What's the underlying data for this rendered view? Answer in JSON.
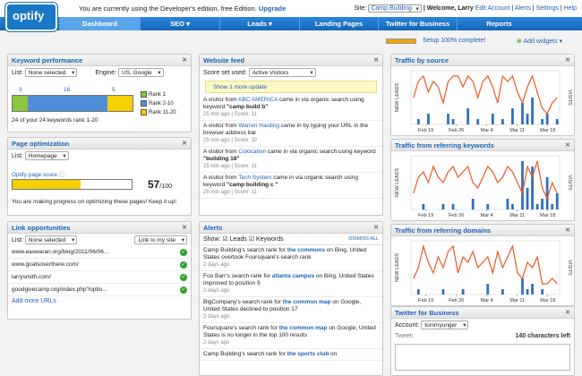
{
  "logo": "optify",
  "header": {
    "dev_note": "You are currently using the Developer's edition, free Edition.",
    "upgrade": "Upgrade",
    "site_label": "Site:",
    "site_value": "Camp Building",
    "welcome": "| Welcome, Larry",
    "links": [
      "Edit Account",
      "Alerts",
      "Settings",
      "Help"
    ]
  },
  "nav": {
    "tabs": [
      "Dashboard",
      "SEO ▾",
      "Leads ▾",
      "Landing Pages",
      "Twitter for Business",
      "Reports"
    ],
    "active": 0
  },
  "setup": {
    "progress": 1.0,
    "text": "Setup 100% complete!",
    "add_widgets": "Add widgets ▾"
  },
  "keyword": {
    "title": "Keyword performance",
    "list_label": "List:",
    "list_value": "None selected",
    "engine_label": "Engine:",
    "engine_value": "US, Google",
    "counts": [
      "3",
      "16",
      "5"
    ],
    "segments": [
      3,
      16,
      5
    ],
    "legend": [
      "Rank 1",
      "Rank 2-10",
      "Rank 11-20"
    ],
    "colors": [
      "#8cc63f",
      "#4e8ed8",
      "#f5d000"
    ],
    "summary": "24 of your 24 keywords rank 1-20"
  },
  "optimization": {
    "title": "Page optimization",
    "list_label": "List:",
    "list_value": "Homepage",
    "score_label": "Optify page score",
    "score": "57",
    "score_max": "/100",
    "score_fraction": 0.57,
    "note": "You are making progress on optimizing these pages! Keep it up!"
  },
  "links": {
    "title": "Link opportunities",
    "list_label": "List:",
    "list_value": "None selected",
    "filter": "Link to my site",
    "rows": [
      "www.easwaran.org/blog/2011/06/06...",
      "www.goatsoverthere.com/",
      "larrysmith.com/",
      "goodgivecamp.org/index.php?optio..."
    ],
    "add_more": "Add more URLs"
  },
  "feed": {
    "title": "Website feed",
    "score_label": "Score set used:",
    "score_value": "Active Visitors",
    "update": "Show 1 more update",
    "items": [
      {
        "pre": "A visitor from ",
        "org": "ABC AMERICA",
        "mid": " came in via organic search using keyword ",
        "kw": "\"camp build b\"",
        "meta": "25 min ago | Score: 11"
      },
      {
        "pre": "A visitor from ",
        "org": "Warren Harding",
        "mid": " came in by typing your URL in the browser address bar",
        "kw": "",
        "meta": "25 min ago | Score: 32"
      },
      {
        "pre": "A visitor from ",
        "org": "Colocation",
        "mid": " came in via organic search using keyword ",
        "kw": "\"building 18\"",
        "meta": "25 min ago | Score: 11"
      },
      {
        "pre": "A visitor from ",
        "org": "Tech System",
        "mid": " came in via organic search using keyword ",
        "kw": "\"camp building c \"",
        "meta": "25 min ago | Score: 11"
      }
    ]
  },
  "alerts": {
    "title": "Alerts",
    "show_label": "Show:",
    "leads": "Leads",
    "keywords": "Keywords",
    "dismiss": "DISMISS ALL",
    "items": [
      {
        "pre": "Camp Building's search rank for ",
        "kw": "the commons",
        "post": " on Bing, United States overtook Foursquare's search rank",
        "meta": "2 days ago"
      },
      {
        "pre": "Foo Barr's search rank for ",
        "kw": "atlanta campus",
        "post": " on Bing, United States improved to position 9",
        "meta": "2 days ago"
      },
      {
        "pre": "BigCompany's search rank for ",
        "kw": "the common map",
        "post": " on Google, United States declined to position 17",
        "meta": "2 days ago"
      },
      {
        "pre": "Foursquare's search rank for ",
        "kw": "the common map",
        "post": " on Google, United States is no longer in the top 100 results",
        "meta": "2 days ago"
      },
      {
        "pre": "Camp Building's search rank for ",
        "kw": "the sports club",
        "post": " on",
        "meta": ""
      }
    ]
  },
  "charts": [
    {
      "title": "Traffic by source",
      "ylabel": "NEW LEADS",
      "y2label": "VISITS",
      "xticks": [
        "Feb 19",
        "Feb 26",
        "Mar 4",
        "Mar 11",
        "Mar 18"
      ]
    },
    {
      "title": "Traffic from referring keywords",
      "ylabel": "NEW LEADS",
      "y2label": "VISITS",
      "xticks": [
        "Feb 19",
        "Feb 26",
        "Mar 4",
        "Mar 11",
        "Mar 18"
      ]
    },
    {
      "title": "Traffic from referring domains",
      "ylabel": "NEW LEADS",
      "y2label": "VISITS",
      "xticks": [
        "Feb 19",
        "Feb 26",
        "Mar 4",
        "Mar 11",
        "Mar 18"
      ]
    }
  ],
  "chart_data": [
    {
      "type": "line",
      "title": "Traffic by source",
      "visits": [
        5,
        8,
        9,
        6,
        8,
        7,
        4,
        8,
        9,
        9,
        7,
        9,
        8,
        5,
        8,
        9,
        7,
        4,
        9,
        8,
        9,
        6,
        4,
        7,
        9,
        6,
        3,
        2,
        4,
        5
      ],
      "leads": [
        0,
        1,
        0,
        2,
        0,
        0,
        0,
        2,
        1,
        0,
        0,
        3,
        0,
        1,
        0,
        0,
        2,
        0,
        1,
        0,
        3,
        0,
        4,
        2,
        5,
        0,
        1,
        2,
        0,
        1
      ]
    },
    {
      "type": "line",
      "title": "Traffic from referring keywords",
      "visits": [
        3,
        6,
        7,
        5,
        8,
        6,
        5,
        7,
        8,
        6,
        7,
        8,
        5,
        4,
        6,
        8,
        7,
        5,
        6,
        8,
        7,
        5,
        3,
        8,
        6,
        9,
        4,
        2,
        5,
        3
      ],
      "leads": [
        0,
        0,
        1,
        0,
        0,
        0,
        1,
        0,
        1,
        0,
        0,
        0,
        2,
        0,
        0,
        1,
        0,
        0,
        0,
        2,
        1,
        0,
        9,
        4,
        8,
        1,
        2,
        6,
        1,
        3
      ]
    },
    {
      "type": "line",
      "title": "Traffic from referring domains",
      "visits": [
        3,
        5,
        9,
        6,
        4,
        7,
        5,
        8,
        9,
        4,
        7,
        6,
        8,
        5,
        6,
        7,
        4,
        8,
        5,
        7,
        9,
        4,
        3,
        6,
        5,
        7,
        2,
        2,
        3,
        2
      ],
      "leads": [
        0,
        1,
        0,
        0,
        0,
        0,
        1,
        0,
        0,
        0,
        1,
        0,
        0,
        0,
        0,
        2,
        0,
        0,
        1,
        0,
        0,
        0,
        3,
        1,
        2,
        0,
        1,
        0,
        0,
        0
      ]
    }
  ],
  "twitter": {
    "title": "Twitter for Business",
    "account_label": "Account:",
    "account_value": "tommyunger",
    "tweet_label": "Tweet:",
    "chars": "140 characters left"
  }
}
